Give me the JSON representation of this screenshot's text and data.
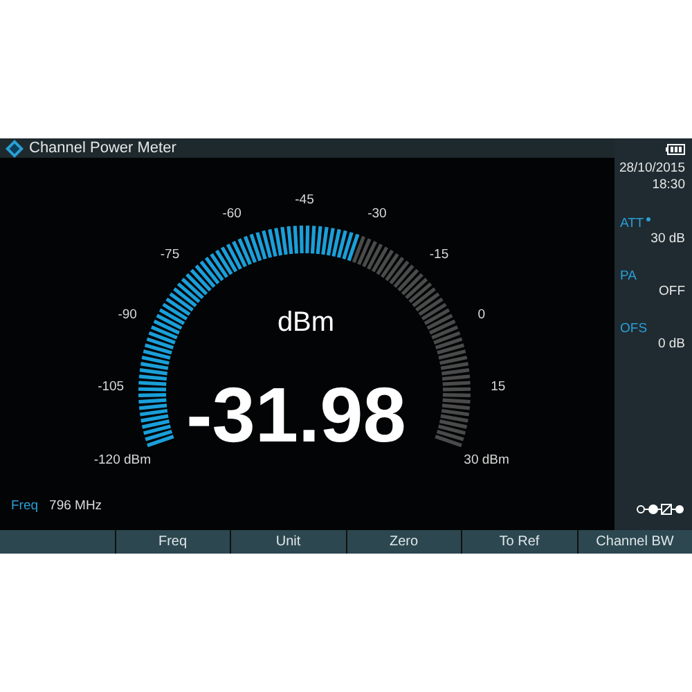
{
  "window": {
    "title": "Channel Power Meter"
  },
  "status": {
    "date": "28/10/2015",
    "time": "18:30",
    "items": [
      {
        "label": "ATT",
        "value": "30 dB",
        "flagged": true
      },
      {
        "label": "PA",
        "value": "OFF",
        "flagged": false
      },
      {
        "label": "OFS",
        "value": "0 dB",
        "flagged": false
      }
    ]
  },
  "gauge": {
    "unit": "dBm",
    "reading": "-31.98",
    "scale_labels": [
      "-45",
      "-60",
      "-30",
      "-75",
      "-15",
      "-90",
      "0",
      "-105",
      "15",
      "-120 dBm",
      "30 dBm"
    ]
  },
  "frequency": {
    "label": "Freq",
    "value": "796 MHz"
  },
  "softkeys": [
    {
      "label": "Freq"
    },
    {
      "label": "Unit"
    },
    {
      "label": "Zero"
    },
    {
      "label": "To Ref"
    },
    {
      "label": "Channel BW"
    }
  ]
}
